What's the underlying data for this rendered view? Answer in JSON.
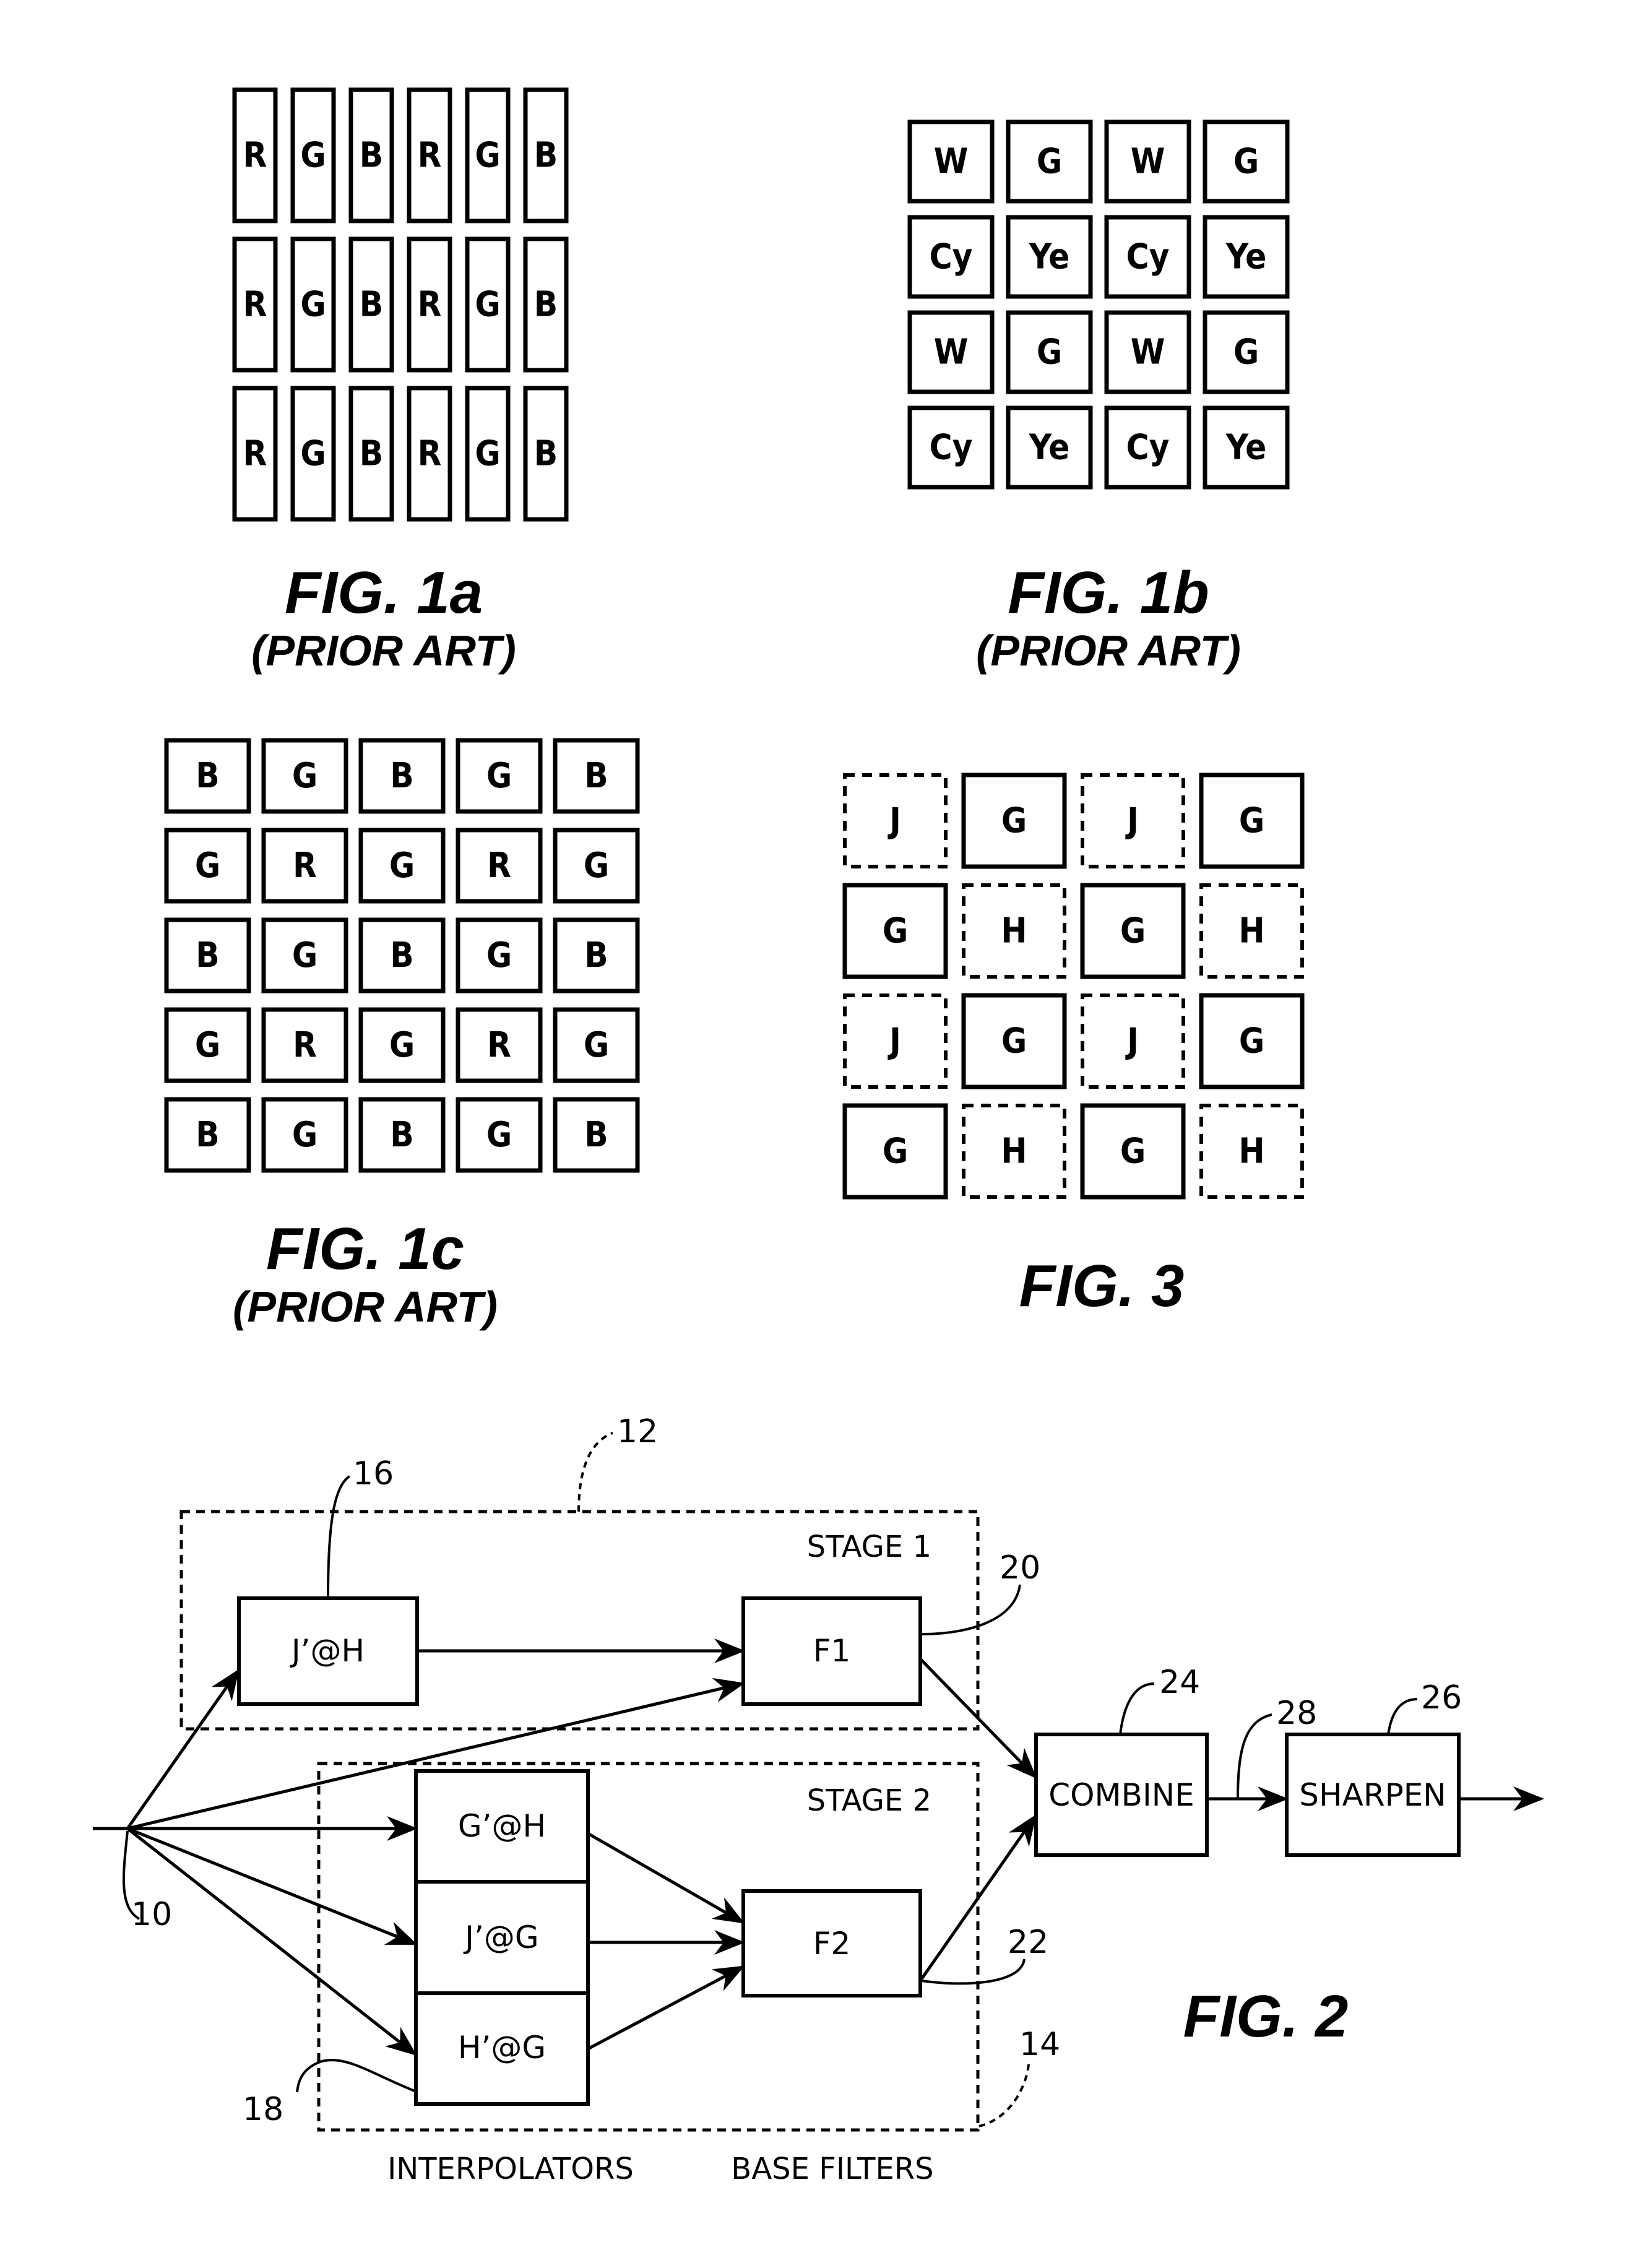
{
  "figures": {
    "fig1a": {
      "label": "FIG. 1a",
      "sub": "(PRIOR ART)",
      "rows": [
        [
          "R",
          "G",
          "B",
          "R",
          "G",
          "B"
        ],
        [
          "R",
          "G",
          "B",
          "R",
          "G",
          "B"
        ],
        [
          "R",
          "G",
          "B",
          "R",
          "G",
          "B"
        ]
      ]
    },
    "fig1b": {
      "label": "FIG. 1b",
      "sub": "(PRIOR ART)",
      "rows": [
        [
          "W",
          "G",
          "W",
          "G"
        ],
        [
          "Cy",
          "Ye",
          "Cy",
          "Ye"
        ],
        [
          "W",
          "G",
          "W",
          "G"
        ],
        [
          "Cy",
          "Ye",
          "Cy",
          "Ye"
        ]
      ]
    },
    "fig1c": {
      "label": "FIG. 1c",
      "sub": "(PRIOR ART)",
      "rows": [
        [
          "B",
          "G",
          "B",
          "G",
          "B"
        ],
        [
          "G",
          "R",
          "G",
          "R",
          "G"
        ],
        [
          "B",
          "G",
          "B",
          "G",
          "B"
        ],
        [
          "G",
          "R",
          "G",
          "R",
          "G"
        ],
        [
          "B",
          "G",
          "B",
          "G",
          "B"
        ]
      ]
    },
    "fig3": {
      "label": "FIG. 3",
      "rows": [
        [
          "J",
          "G",
          "J",
          "G"
        ],
        [
          "G",
          "H",
          "G",
          "H"
        ],
        [
          "J",
          "G",
          "J",
          "G"
        ],
        [
          "G",
          "H",
          "G",
          "H"
        ]
      ],
      "dashed_cells": [
        "J",
        "H"
      ]
    },
    "fig2": {
      "label": "FIG. 2",
      "stage1_label": "STAGE 1",
      "stage2_label": "STAGE 2",
      "blocks": {
        "j_at_h": "J’@H",
        "f1": "F1",
        "g_at_h": "G’@H",
        "j_at_g": "J’@G",
        "h_at_g": "H’@G",
        "f2": "F2",
        "combine": "COMBINE",
        "sharpen": "SHARPEN"
      },
      "refs": {
        "input": "10",
        "stage1": "12",
        "stage2": "14",
        "interp1": "16",
        "interp2": "18",
        "f1_out": "20",
        "f2_out": "22",
        "combine": "24",
        "sharpen": "26",
        "combined_signal": "28"
      },
      "captions": {
        "interpolators": "INTERPOLATORS",
        "base_filters": "BASE FILTERS"
      }
    }
  }
}
